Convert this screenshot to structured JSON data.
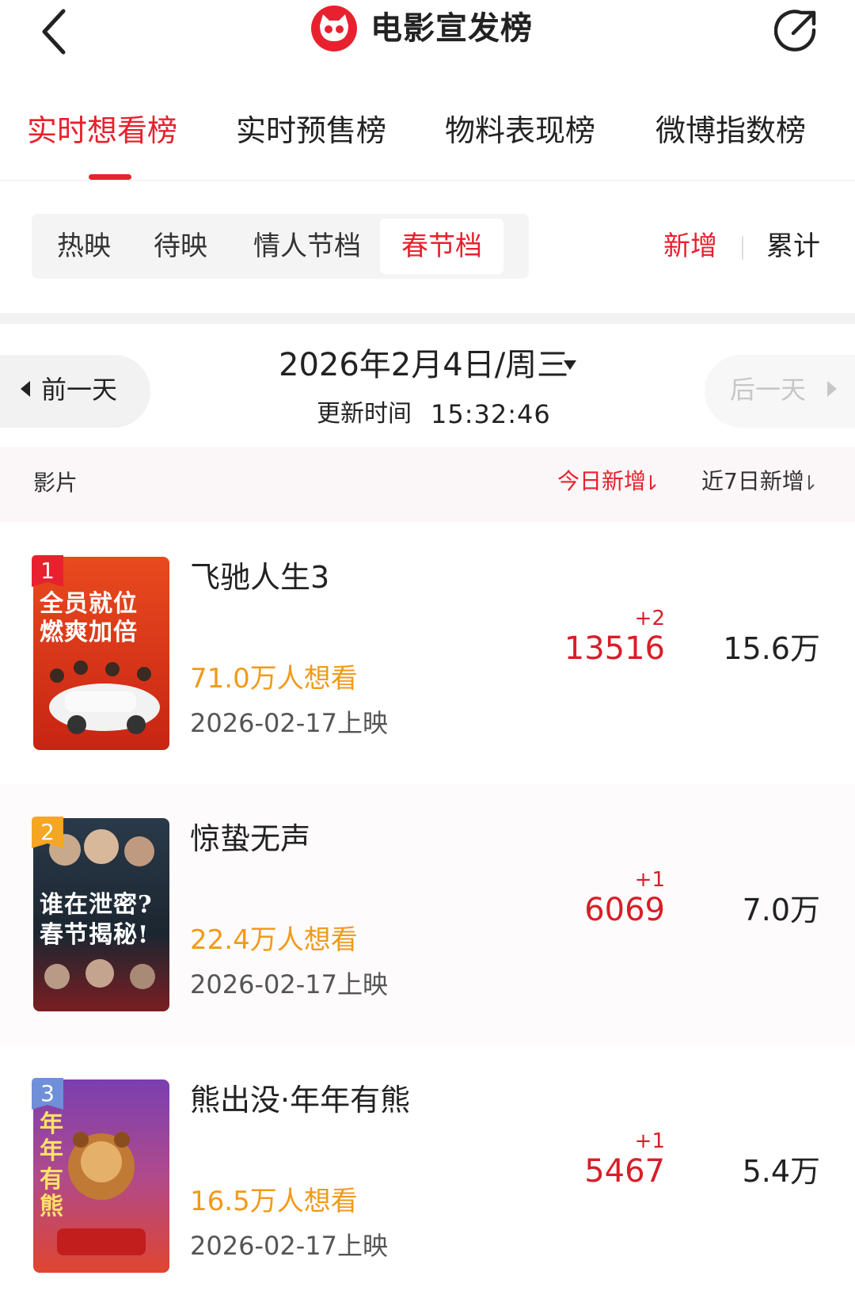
{
  "header": {
    "title": "电影宣发榜",
    "logo_icon": "cat-eye-logo",
    "back_icon": "chevron-left-icon",
    "share_icon": "share-icon"
  },
  "tabs": [
    {
      "label": "实时想看榜",
      "active": true
    },
    {
      "label": "实时预售榜",
      "active": false
    },
    {
      "label": "物料表现榜",
      "active": false
    },
    {
      "label": "微博指数榜",
      "active": false
    }
  ],
  "segments": [
    {
      "label": "热映",
      "active": false
    },
    {
      "label": "待映",
      "active": false
    },
    {
      "label": "情人节档",
      "active": false
    },
    {
      "label": "春节档",
      "active": true
    }
  ],
  "toggle": {
    "new_label": "新增",
    "cumulative_label": "累计",
    "selected": "新增"
  },
  "datebar": {
    "prev_label": "前一天",
    "next_label": "后一天",
    "date": "2026年2月4日/周三",
    "update_label": "更新时间",
    "update_time": "15:32:46"
  },
  "columns": {
    "film": "影片",
    "today": "今日新增",
    "week": "近7日新增"
  },
  "movies": [
    {
      "rank": "1",
      "badge_color": "#e8212e",
      "title": "飞驰人生3",
      "want": "71.0万人想看",
      "release": "2026-02-17上映",
      "delta": "+2",
      "today": "13516",
      "week": "15.6万",
      "poster_text": [
        "全员就位",
        "燃爽加倍"
      ],
      "poster_colors": [
        "#e94a1e",
        "#c82414"
      ]
    },
    {
      "rank": "2",
      "badge_color": "#f5a623",
      "title": "惊蛰无声",
      "want": "22.4万人想看",
      "release": "2026-02-17上映",
      "delta": "+1",
      "today": "6069",
      "week": "7.0万",
      "poster_text": [
        "谁在泄密?",
        "春节揭秘!"
      ],
      "poster_colors": [
        "#2a3a4a",
        "#7a1e22"
      ]
    },
    {
      "rank": "3",
      "badge_color": "#6f8fd8",
      "title": "熊出没·年年有熊",
      "want": "16.5万人想看",
      "release": "2026-02-17上映",
      "delta": "+1",
      "today": "5467",
      "week": "5.4万",
      "poster_text": [
        "年年",
        "有熊"
      ],
      "poster_colors": [
        "#7a3fb0",
        "#e0452e"
      ]
    }
  ]
}
